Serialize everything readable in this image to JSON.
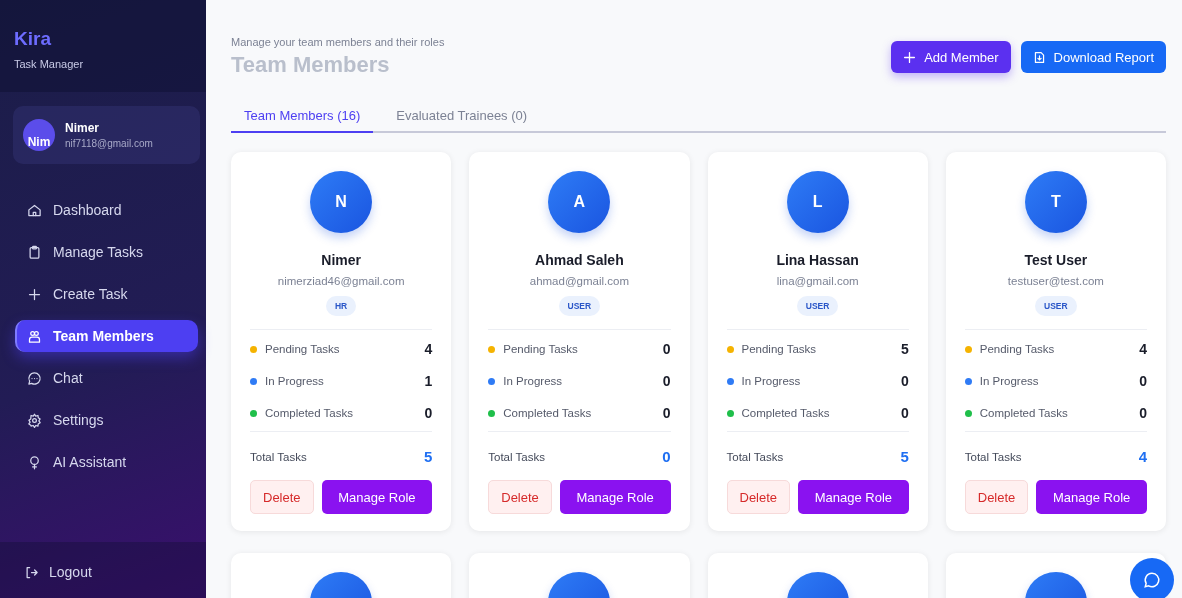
{
  "brand": {
    "name": "Kira",
    "subtitle": "Task Manager"
  },
  "user": {
    "avatar_text": "Nim",
    "name": "Nimer",
    "email": "nif7118@gmail.com"
  },
  "nav": [
    {
      "label": "Dashboard",
      "selected": false
    },
    {
      "label": "Manage Tasks",
      "selected": false
    },
    {
      "label": "Create Task",
      "selected": false
    },
    {
      "label": "Team Members",
      "selected": true
    },
    {
      "label": "Chat",
      "selected": false
    },
    {
      "label": "Settings",
      "selected": false
    },
    {
      "label": "AI Assistant",
      "selected": false
    }
  ],
  "logout": "Logout",
  "header": {
    "subtitle": "Manage your team members and their roles",
    "title": "Team Members"
  },
  "actions": [
    {
      "label": "Add Member",
      "kind": "add"
    },
    {
      "label": "Download Report",
      "kind": "download"
    }
  ],
  "tabs": [
    {
      "label": "Team Members (16)",
      "selected": true
    },
    {
      "label": "Evaluated Trainees (0)",
      "selected": false
    }
  ],
  "members": [
    {
      "initial": "N",
      "name": "Nimer",
      "email": "nimerziad46@gmail.com",
      "role": "HR",
      "stats": [
        {
          "label": "Pending Tasks",
          "value": "4",
          "color": "#f5b301"
        },
        {
          "label": "In Progress",
          "value": "1",
          "color": "#2f7bf5"
        },
        {
          "label": "Completed Tasks",
          "value": "0",
          "color": "#1fbf4a"
        }
      ],
      "total_label": "Total Tasks",
      "total": "5",
      "delete": "Delete",
      "manage": "Manage Role"
    },
    {
      "initial": "A",
      "name": "Ahmad Saleh",
      "email": "ahmad@gmail.com",
      "role": "USER",
      "stats": [
        {
          "label": "Pending Tasks",
          "value": "0",
          "color": "#f5b301"
        },
        {
          "label": "In Progress",
          "value": "0",
          "color": "#2f7bf5"
        },
        {
          "label": "Completed Tasks",
          "value": "0",
          "color": "#1fbf4a"
        }
      ],
      "total_label": "Total Tasks",
      "total": "0",
      "delete": "Delete",
      "manage": "Manage Role"
    },
    {
      "initial": "L",
      "name": "Lina Hassan",
      "email": "lina@gmail.com",
      "role": "USER",
      "stats": [
        {
          "label": "Pending Tasks",
          "value": "5",
          "color": "#f5b301"
        },
        {
          "label": "In Progress",
          "value": "0",
          "color": "#2f7bf5"
        },
        {
          "label": "Completed Tasks",
          "value": "0",
          "color": "#1fbf4a"
        }
      ],
      "total_label": "Total Tasks",
      "total": "5",
      "delete": "Delete",
      "manage": "Manage Role"
    },
    {
      "initial": "T",
      "name": "Test User",
      "email": "testuser@test.com",
      "role": "USER",
      "stats": [
        {
          "label": "Pending Tasks",
          "value": "4",
          "color": "#f5b301"
        },
        {
          "label": "In Progress",
          "value": "0",
          "color": "#2f7bf5"
        },
        {
          "label": "Completed Tasks",
          "value": "0",
          "color": "#1fbf4a"
        }
      ],
      "total_label": "Total Tasks",
      "total": "4",
      "delete": "Delete",
      "manage": "Manage Role"
    }
  ]
}
